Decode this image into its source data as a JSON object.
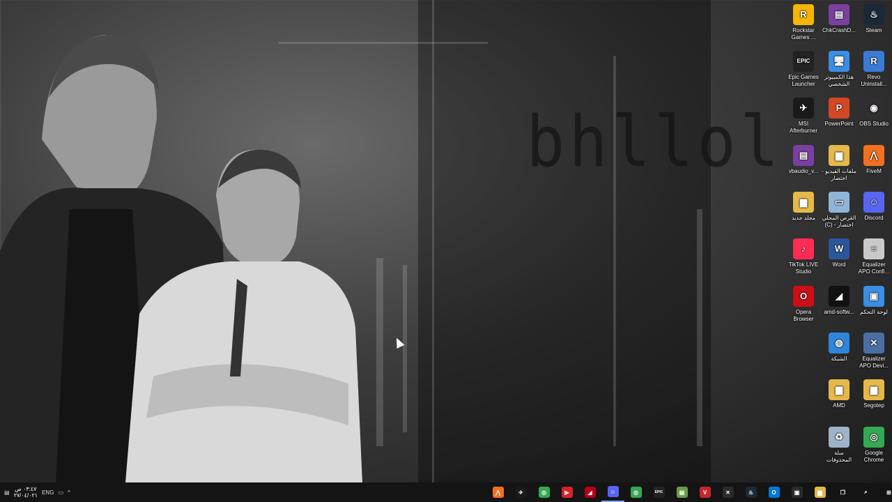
{
  "wallpaper": {
    "brush_text": "bhllol"
  },
  "desktop_icons": [
    {
      "label": "Rockstar Games ...",
      "icon": "rockstar-icon",
      "color": "#f6b500",
      "glyph": "R"
    },
    {
      "label": "ChkCrashD...",
      "icon": "winrar-icon",
      "color": "#7b3fa0",
      "glyph": "▤"
    },
    {
      "label": "Steam",
      "icon": "steam-icon",
      "color": "#1b2838",
      "glyph": "♨"
    },
    {
      "label": "Epic Games Launcher",
      "icon": "epic-games-icon",
      "color": "#222222",
      "glyph": "EPIC"
    },
    {
      "label": "هذا الكمبيوتر الشخصي",
      "icon": "this-pc-icon",
      "color": "#3a8ee6",
      "glyph": "🖥"
    },
    {
      "label": "Revo Uninstall...",
      "icon": "revo-uninstaller-icon",
      "color": "#3a7bd5",
      "glyph": "R"
    },
    {
      "label": "MSI Afterburner",
      "icon": "msi-afterburner-icon",
      "color": "#1a1a1a",
      "glyph": "✈"
    },
    {
      "label": "PowerPoint",
      "icon": "powerpoint-icon",
      "color": "#d24726",
      "glyph": "P"
    },
    {
      "label": "OBS Studio",
      "icon": "obs-icon",
      "color": "#302e31",
      "glyph": "◉"
    },
    {
      "label": "vbaudio_v...",
      "icon": "winrar-icon",
      "color": "#7b3fa0",
      "glyph": "▤"
    },
    {
      "label": "ملفات الفيديو - اختصار",
      "icon": "folder-shortcut-icon",
      "color": "#e6b84a",
      "glyph": "▆"
    },
    {
      "label": "FiveM",
      "icon": "fivem-icon",
      "color": "#f37021",
      "glyph": "⋀"
    },
    {
      "label": "مجلد جديد",
      "icon": "folder-icon",
      "color": "#e6b84a",
      "glyph": "▆"
    },
    {
      "label": "القرص المحلي (C) - اختصار",
      "icon": "local-disk-icon",
      "color": "#8fb6d9",
      "glyph": "▭"
    },
    {
      "label": "Discord",
      "icon": "discord-icon",
      "color": "#5865f2",
      "glyph": "☺"
    },
    {
      "label": "TikTok LIVE Studio",
      "icon": "tiktok-icon",
      "color": "#fe2c55",
      "glyph": "♪"
    },
    {
      "label": "Word",
      "icon": "word-icon",
      "color": "#2b579a",
      "glyph": "W"
    },
    {
      "label": "Equalizer APO Confi...",
      "icon": "equalizer-config-icon",
      "color": "#c9c9c9",
      "glyph": "≡"
    },
    {
      "label": "Opera Browser",
      "icon": "opera-icon",
      "color": "#cc0f16",
      "glyph": "O"
    },
    {
      "label": "amd-softw...",
      "icon": "amd-icon",
      "color": "#111111",
      "glyph": "◢"
    },
    {
      "label": "لوحة التحكم",
      "icon": "control-panel-icon",
      "color": "#3a8ee6",
      "glyph": "▣"
    },
    {
      "label": "الشبكة",
      "icon": "network-icon",
      "color": "#2f86d9",
      "glyph": "◍"
    },
    {
      "label": "Equalizer APO Devi...",
      "icon": "equalizer-device-icon",
      "color": "#4a6fa5",
      "glyph": "✕"
    },
    {
      "label": "AMD",
      "icon": "folder-icon",
      "color": "#e6b84a",
      "glyph": "▆"
    },
    {
      "label": "Segotep",
      "icon": "folder-icon",
      "color": "#e6b84a",
      "glyph": "▆"
    },
    {
      "label": "سلة المحذوفات",
      "icon": "recycle-bin-icon",
      "color": "#9fb3c8",
      "glyph": "♻"
    },
    {
      "label": "Google Chrome",
      "icon": "chrome-icon",
      "color": "#34a853",
      "glyph": "◎"
    }
  ],
  "taskbar": {
    "clock_time": "٠٣:٤٧ ص",
    "clock_date": "٢٧/٠٤/٠٢١",
    "language": "ENG",
    "apps": [
      {
        "icon": "fivem-icon",
        "color": "#f37021",
        "glyph": "⋀"
      },
      {
        "icon": "msi-afterburner-icon",
        "color": "#1a1a1a",
        "glyph": "✈"
      },
      {
        "icon": "chrome-icon",
        "color": "#34a853",
        "glyph": "◎"
      },
      {
        "icon": "screen-recorder-icon",
        "color": "#d6222a",
        "glyph": "▶"
      },
      {
        "icon": "rockstar-launcher-icon",
        "color": "#b3001b",
        "glyph": "◢"
      },
      {
        "icon": "discord-icon",
        "color": "#5865f2",
        "glyph": "☺",
        "active": true
      },
      {
        "icon": "chrome-icon",
        "color": "#34a853",
        "glyph": "◎"
      },
      {
        "icon": "epic-games-icon",
        "color": "#222222",
        "glyph": "EPIC"
      },
      {
        "icon": "notepad-icon",
        "color": "#6a9c4a",
        "glyph": "▤"
      },
      {
        "icon": "voicemod-icon",
        "color": "#c9252c",
        "glyph": "V"
      },
      {
        "icon": "tools-icon",
        "color": "#2b2b2b",
        "glyph": "✕"
      },
      {
        "icon": "steam-icon",
        "color": "#1b2838",
        "glyph": "♨"
      },
      {
        "icon": "outlook-icon",
        "color": "#0078d4",
        "glyph": "O"
      },
      {
        "icon": "store-icon",
        "color": "#2b2b2b",
        "glyph": "▣"
      },
      {
        "icon": "file-explorer-icon",
        "color": "#e6b84a",
        "glyph": "▆"
      },
      {
        "icon": "task-view-icon",
        "color": "#141414",
        "glyph": "❐"
      },
      {
        "icon": "search-icon",
        "color": "#141414",
        "glyph": "⌕"
      },
      {
        "icon": "start-icon",
        "color": "#141414",
        "glyph": "⊞"
      }
    ]
  }
}
